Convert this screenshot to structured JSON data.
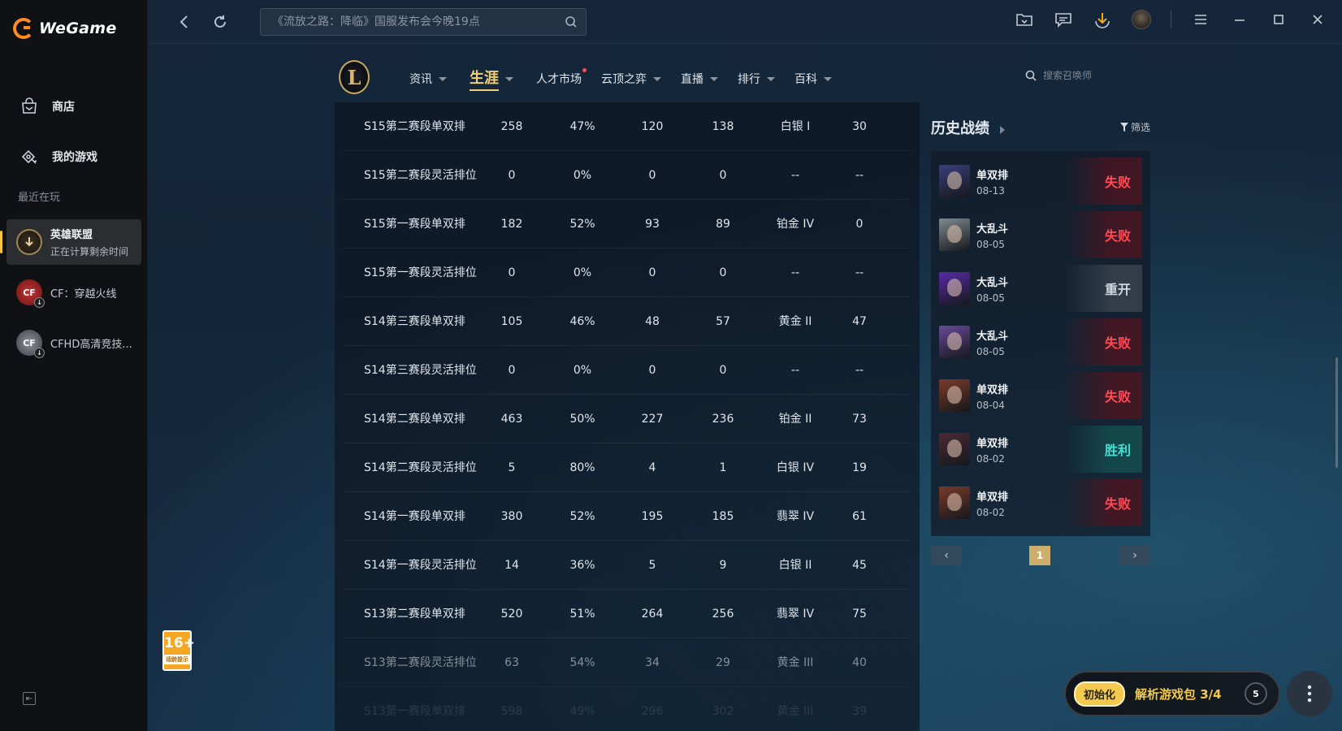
{
  "app": {
    "name": "WeGame"
  },
  "sidebar": {
    "nav": [
      {
        "label": "商店",
        "icon": "store-icon"
      },
      {
        "label": "我的游戏",
        "icon": "gamepad-icon"
      }
    ],
    "recent_title": "最近在玩",
    "recent": [
      {
        "name": "英雄联盟",
        "sub": "正在计算剩余时间"
      },
      {
        "name": "CF：穿越火线"
      },
      {
        "name": "CFHD高清竞技..."
      }
    ],
    "age_rating": {
      "number": "16+",
      "text": "适龄提示"
    }
  },
  "topbar": {
    "search_placeholder": "《流放之路：降临》国服发布会今晚19点"
  },
  "game_nav": {
    "tabs": [
      {
        "label": "资讯",
        "caret": true
      },
      {
        "label": "生涯",
        "caret": true,
        "active": true
      },
      {
        "label": "人才市场",
        "caret": false,
        "dot": true
      },
      {
        "label": "云顶之弈",
        "caret": true
      },
      {
        "label": "直播",
        "caret": true
      },
      {
        "label": "排行",
        "caret": true
      },
      {
        "label": "百科",
        "caret": true
      }
    ],
    "summoner_search_placeholder": "搜索召唤师"
  },
  "season_stats": {
    "rows": [
      {
        "season": "S15第二赛段单双排",
        "total": "258",
        "winrate": "47%",
        "wins": "120",
        "losses": "138",
        "rank": "白银 I",
        "lp": "30"
      },
      {
        "season": "S15第二赛段灵活排位",
        "total": "0",
        "winrate": "0%",
        "wins": "0",
        "losses": "0",
        "rank": "--",
        "lp": "--"
      },
      {
        "season": "S15第一赛段单双排",
        "total": "182",
        "winrate": "52%",
        "wins": "93",
        "losses": "89",
        "rank": "铂金 IV",
        "lp": "0"
      },
      {
        "season": "S15第一赛段灵活排位",
        "total": "0",
        "winrate": "0%",
        "wins": "0",
        "losses": "0",
        "rank": "--",
        "lp": "--"
      },
      {
        "season": "S14第三赛段单双排",
        "total": "105",
        "winrate": "46%",
        "wins": "48",
        "losses": "57",
        "rank": "黄金 II",
        "lp": "47"
      },
      {
        "season": "S14第三赛段灵活排位",
        "total": "0",
        "winrate": "0%",
        "wins": "0",
        "losses": "0",
        "rank": "--",
        "lp": "--"
      },
      {
        "season": "S14第二赛段单双排",
        "total": "463",
        "winrate": "50%",
        "wins": "227",
        "losses": "236",
        "rank": "铂金 II",
        "lp": "73"
      },
      {
        "season": "S14第二赛段灵活排位",
        "total": "5",
        "winrate": "80%",
        "wins": "4",
        "losses": "1",
        "rank": "白银 IV",
        "lp": "19"
      },
      {
        "season": "S14第一赛段单双排",
        "total": "380",
        "winrate": "52%",
        "wins": "195",
        "losses": "185",
        "rank": "翡翠 IV",
        "lp": "61"
      },
      {
        "season": "S14第一赛段灵活排位",
        "total": "14",
        "winrate": "36%",
        "wins": "5",
        "losses": "9",
        "rank": "白银 II",
        "lp": "45"
      },
      {
        "season": "S13第二赛段单双排",
        "total": "520",
        "winrate": "51%",
        "wins": "264",
        "losses": "256",
        "rank": "翡翠 IV",
        "lp": "75"
      },
      {
        "season": "S13第二赛段灵活排位",
        "total": "63",
        "winrate": "54%",
        "wins": "34",
        "losses": "29",
        "rank": "黄金 III",
        "lp": "40"
      },
      {
        "season": "S13第一赛段单双排",
        "total": "598",
        "winrate": "49%",
        "wins": "296",
        "losses": "302",
        "rank": "黄金 III",
        "lp": "39"
      }
    ]
  },
  "history": {
    "title": "历史战绩",
    "filter_label": "筛选",
    "matches": [
      {
        "mode": "单双排",
        "date": "08-13",
        "result": "失败",
        "type": "lose",
        "champ_color": "#3b3f7a"
      },
      {
        "mode": "大乱斗",
        "date": "08-05",
        "result": "失败",
        "type": "lose",
        "champ_color": "#7f8a90"
      },
      {
        "mode": "大乱斗",
        "date": "08-05",
        "result": "重开",
        "type": "remake",
        "champ_color": "#5a2aa8"
      },
      {
        "mode": "大乱斗",
        "date": "08-05",
        "result": "失败",
        "type": "lose",
        "champ_color": "#6a4a9a"
      },
      {
        "mode": "单双排",
        "date": "08-04",
        "result": "失败",
        "type": "lose",
        "champ_color": "#7a3a2a"
      },
      {
        "mode": "单双排",
        "date": "08-02",
        "result": "胜利",
        "type": "win",
        "champ_color": "#4a2a35"
      },
      {
        "mode": "单双排",
        "date": "08-02",
        "result": "失败",
        "type": "lose",
        "champ_color": "#7a3a2a"
      }
    ],
    "pager": {
      "prev": "‹",
      "page": "1",
      "next": "›"
    }
  },
  "download": {
    "state": "初始化",
    "text": "解析游戏包 3/4",
    "count": "5"
  }
}
